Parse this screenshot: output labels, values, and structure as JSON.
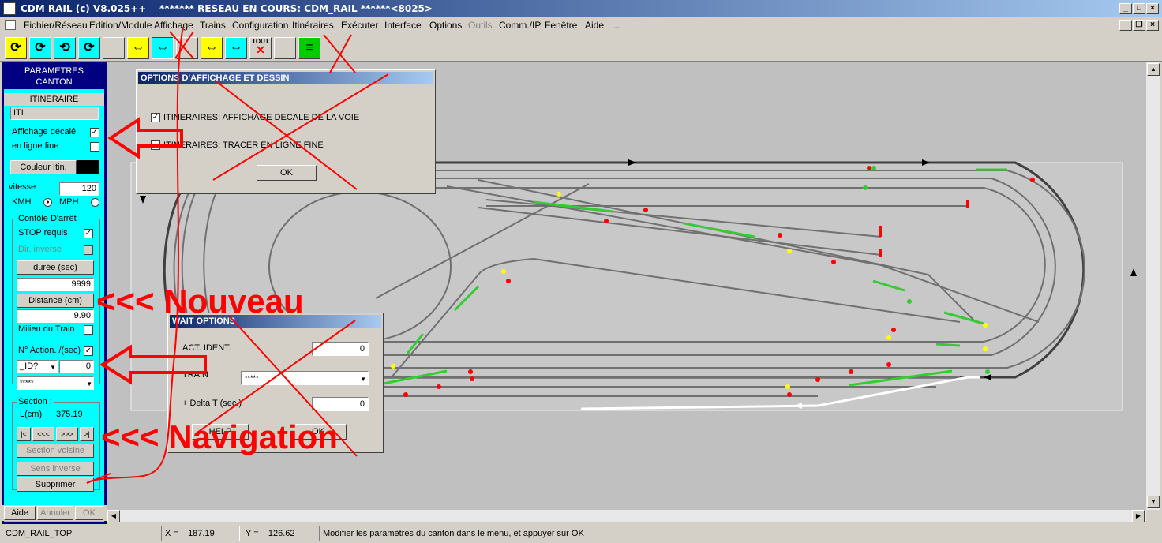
{
  "window": {
    "title": "CDM RAIL (c) V8.025++    ******* RESEAU EN COURS: CDM_RAIL ******<8025>",
    "minimize": "_",
    "maximize": "□",
    "close": "×",
    "restore": "❐"
  },
  "menu": {
    "items": [
      "Fichier/Réseau",
      "Edition/Module",
      "Affichage",
      "Trains",
      "Configuration",
      "Itinéraires",
      "Exécuter",
      "Interface",
      "Options",
      "Outils",
      "Comm./IP",
      "Fenêtre",
      "Aide",
      "..."
    ],
    "disabled_item": "Outils"
  },
  "toolbar": {
    "tout_label": "TOUT"
  },
  "panel": {
    "header_line1": "PARAMETRES",
    "header_line2": "CANTON",
    "itineraire_label": "ITINERAIRE",
    "itineraire_value": "ITI",
    "affichage_decale": "Affichage décalé",
    "en_ligne_fine": "en ligne fine",
    "couleur_btn": "Couleur Itin.",
    "vitesse_label": "vitesse",
    "vitesse_value": "120",
    "kmh": "KMH",
    "mph": "MPH",
    "controle_title": "Contôle D'arrêt",
    "stop_requis": "STOP requis",
    "dir_inverse": "Dir. inverse",
    "duree_btn": "durée (sec)",
    "duree_value": "9999",
    "distance_btn": "Distance (cm)",
    "distance_value": "9.90",
    "milieu_train": "Milieu du Train",
    "n_action": "N° Action. /(sec)",
    "id_select": "_ID?",
    "action_value": "0",
    "train_select": "*****",
    "section_title": "Section :",
    "lcm_label": "L(cm)",
    "lcm_value": "375.19",
    "nav_first": "|<",
    "nav_prev": "<<<",
    "nav_next": ">>>",
    "nav_last": ">|",
    "section_voisine": "Section voisine",
    "sens_inverse": "Sens inverse",
    "supprimer": "Supprimer",
    "aide": "Aide",
    "annuler": "Annuler",
    "ok": "OK"
  },
  "dialog_options": {
    "title": "OPTIONS D'AFFICHAGE ET DESSIN",
    "opt1": "ITINERAIRES: AFFICHAGE DECALE DE LA VOIE",
    "opt2": "ITINERAIRES: TRACER EN LIGNE FINE",
    "ok": "OK"
  },
  "dialog_wait": {
    "title": "WAIT OPTIONS",
    "act_ident_label": "ACT. IDENT.",
    "act_ident_value": "0",
    "train_label": "TRAIN",
    "train_value": "*****",
    "delta_label": "+ Delta T (sec.)",
    "delta_value": "0",
    "help": "HELP",
    "ok": "OK"
  },
  "annotations": {
    "nouveau": "<<< Nouveau",
    "navigation": "<<< Navigation"
  },
  "status": {
    "module": "CDM_RAIL_TOP",
    "x_label": "X =",
    "x_value": "187.19",
    "y_label": "Y =",
    "y_value": "126.62",
    "message": "Modifier les paramètres du canton dans le menu, et appuyer sur OK"
  },
  "colors": {
    "panel_bg": "#00ffff",
    "panel_border": "#000080",
    "annotation": "#ff0000",
    "track": "#606060",
    "route_green": "#33cc33"
  }
}
